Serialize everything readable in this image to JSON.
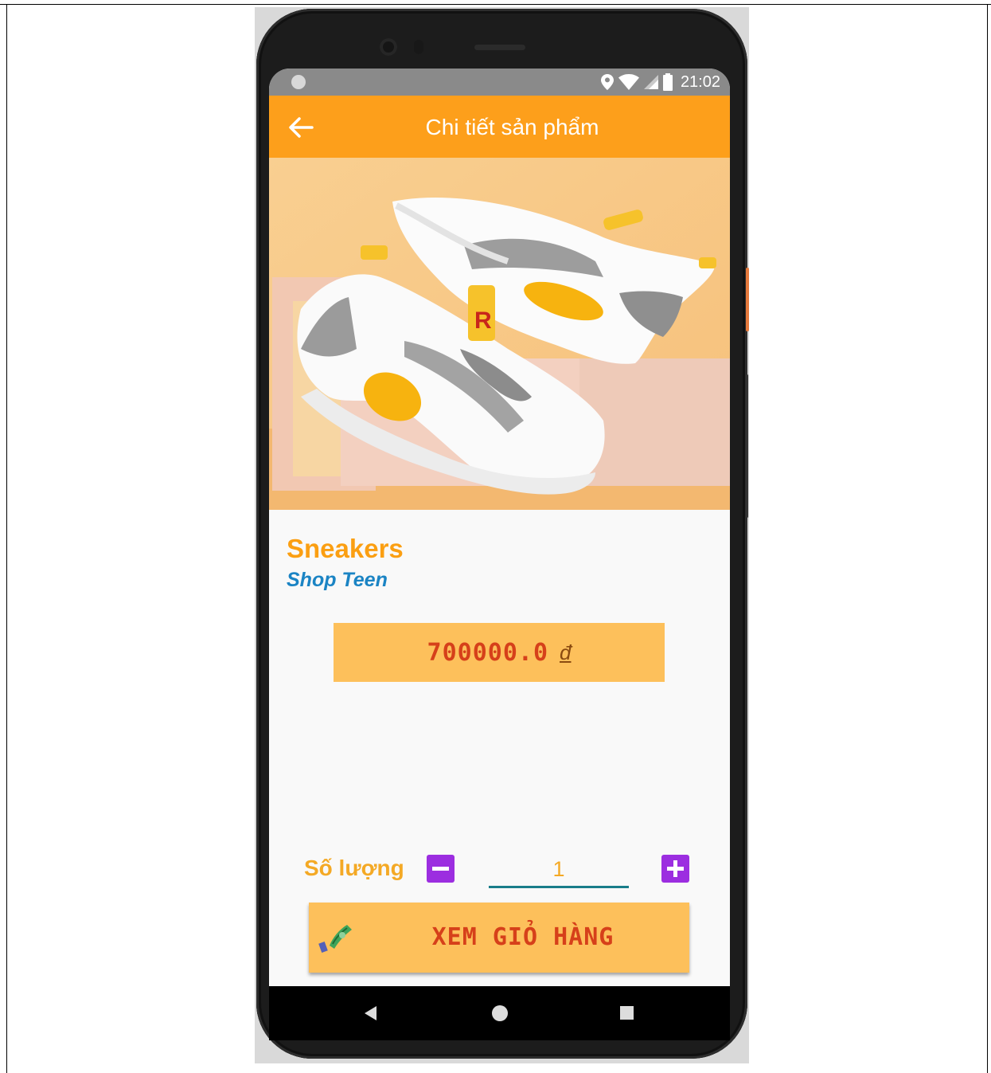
{
  "status_bar": {
    "time": "21:02"
  },
  "app_bar": {
    "title": "Chi tiết sản phẩm"
  },
  "product": {
    "name": "Sneakers",
    "shop": "Shop Teen",
    "price": "700000.0",
    "currency": "đ"
  },
  "quantity": {
    "label": "Số lượng",
    "value": "1"
  },
  "cart_button": {
    "label": "XEM GIỎ HÀNG"
  },
  "colors": {
    "accent": "#fd9f1b",
    "price_bg": "#fdc05b",
    "price_text": "#d6401a",
    "qty_button": "#9c2ee0",
    "shop_text": "#1b84c4"
  },
  "icons": [
    "back-arrow-icon",
    "location-icon",
    "wifi-icon",
    "signal-icon",
    "battery-icon",
    "minus-icon",
    "plus-icon",
    "money-icon",
    "nav-back-icon",
    "nav-home-icon",
    "nav-recents-icon"
  ]
}
